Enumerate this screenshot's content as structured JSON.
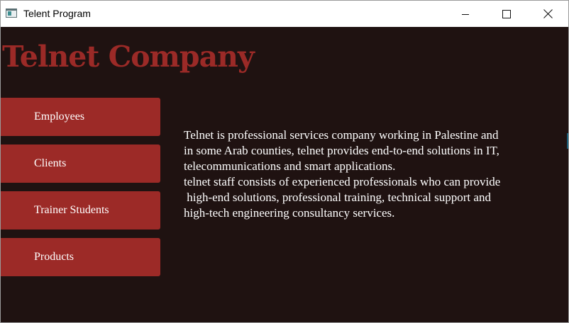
{
  "window": {
    "title": "Telent Program",
    "controls": {
      "minimize_icon": "minimize-icon",
      "maximize_icon": "maximize-icon",
      "close_icon": "close-icon"
    }
  },
  "page": {
    "heading": "Telnet Company",
    "nav": [
      {
        "label": "Employees"
      },
      {
        "label": "Clients"
      },
      {
        "label": "Trainer Students"
      },
      {
        "label": "Products"
      }
    ],
    "description": [
      "Telnet is professional services company working in Palestine and",
      "in some Arab counties, telnet provides end-to-end solutions in IT,",
      "telecommunications and smart applications.",
      "telnet staff consists of experienced professionals who can provide",
      " high-end solutions, professional training, technical support and",
      "high-tech engineering consultancy services."
    ]
  },
  "colors": {
    "background": "#1f1211",
    "accent": "#9c2a27",
    "text": "#ffffff",
    "titlebar": "#ffffff"
  }
}
